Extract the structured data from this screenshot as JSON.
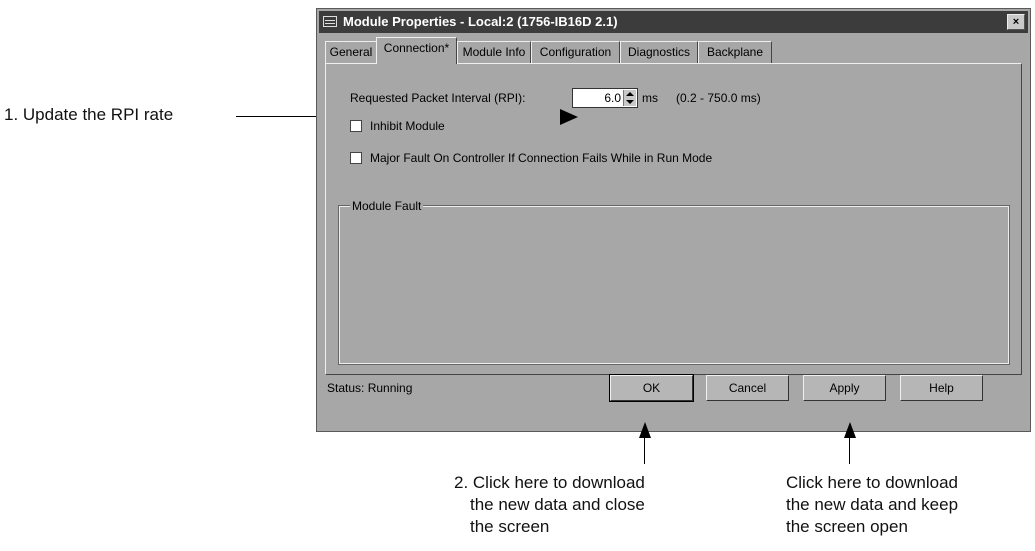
{
  "window": {
    "title": "Module Properties - Local:2 (1756-IB16D 2.1)",
    "close_glyph": "×"
  },
  "tabs": [
    {
      "label": "General"
    },
    {
      "label": "Connection*"
    },
    {
      "label": "Module Info"
    },
    {
      "label": "Configuration"
    },
    {
      "label": "Diagnostics"
    },
    {
      "label": "Backplane"
    }
  ],
  "connection": {
    "rpi_label": "Requested Packet Interval (RPI):",
    "rpi_value": "6.0",
    "rpi_unit": "ms",
    "rpi_range": "(0.2 - 750.0 ms)",
    "inhibit_label": "Inhibit Module",
    "major_fault_label": "Major Fault On Controller If Connection Fails While in Run Mode",
    "module_fault_label": "Module Fault"
  },
  "footer": {
    "status": "Status:  Running",
    "ok_label": "OK",
    "cancel_label": "Cancel",
    "apply_label": "Apply",
    "help_label": "Help"
  },
  "annotations": {
    "step1": "1. Update the RPI rate",
    "step2_line1": "2. Click here to download",
    "step2_line2": "the new data and close",
    "step2_line3": "the screen",
    "apply_line1": "Click here to download",
    "apply_line2": "the new data and keep",
    "apply_line3": "the screen open"
  }
}
